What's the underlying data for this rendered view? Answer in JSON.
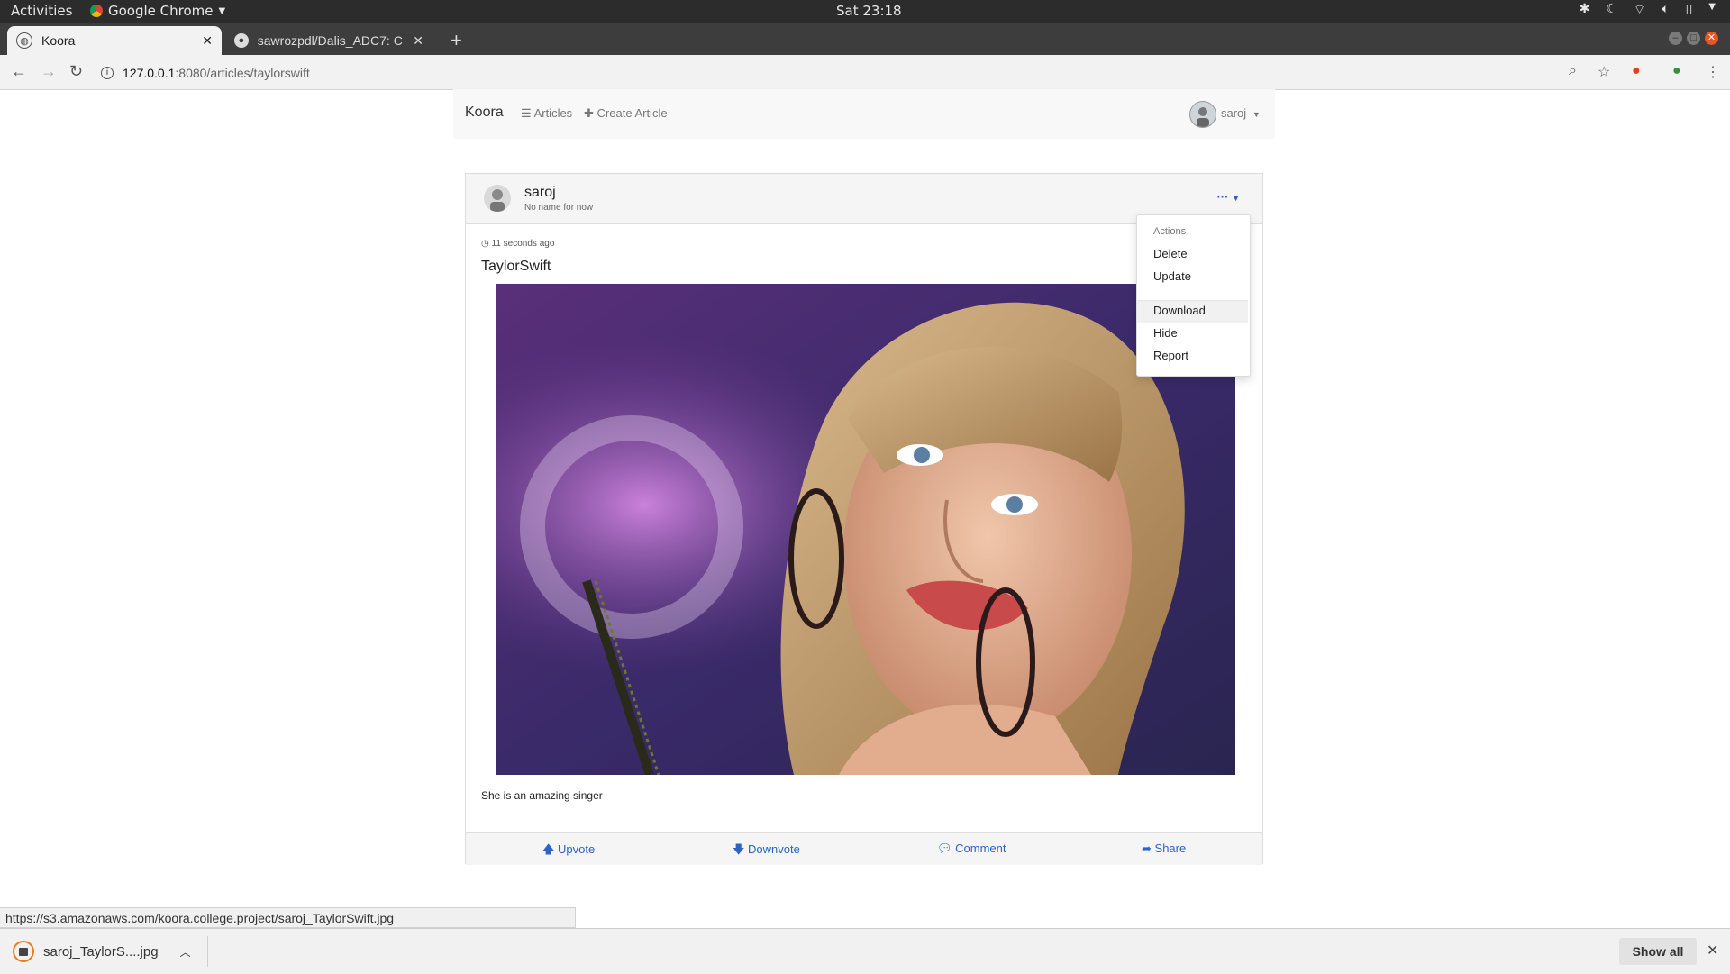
{
  "system_bar": {
    "activities": "Activities",
    "app_name": "Google Chrome",
    "clock": "Sat 23:18"
  },
  "browser": {
    "tabs": [
      {
        "title": "Koora",
        "active": true
      },
      {
        "title": "sawrozpdl/Dalis_ADC7: C",
        "active": false
      }
    ],
    "url_host": "127.0.0.1",
    "url_path": ":8080/articles/taylorswift",
    "status_url": "https://s3.amazonaws.com/koora.college.project/saroj_TaylorSwift.jpg"
  },
  "site_nav": {
    "brand": "Koora",
    "links": [
      "Articles",
      "Create Article"
    ],
    "user": "saroj"
  },
  "article": {
    "author": "saroj",
    "author_subtitle": "No name for now",
    "timestamp": "11 seconds ago",
    "title": "TaylorSwift",
    "caption": "She is an amazing singer",
    "actions": [
      "Upvote",
      "Downvote",
      "Comment",
      "Share"
    ]
  },
  "dropdown": {
    "header": "Actions",
    "items": [
      "Delete",
      "Update",
      "Download",
      "Hide",
      "Report"
    ],
    "hovered": "Download"
  },
  "downloads": {
    "file_name": "saroj_TaylorS....jpg",
    "show_all": "Show all"
  },
  "colors": {
    "link_blue": "#2b63c6",
    "download_ring": "#e67e22"
  }
}
